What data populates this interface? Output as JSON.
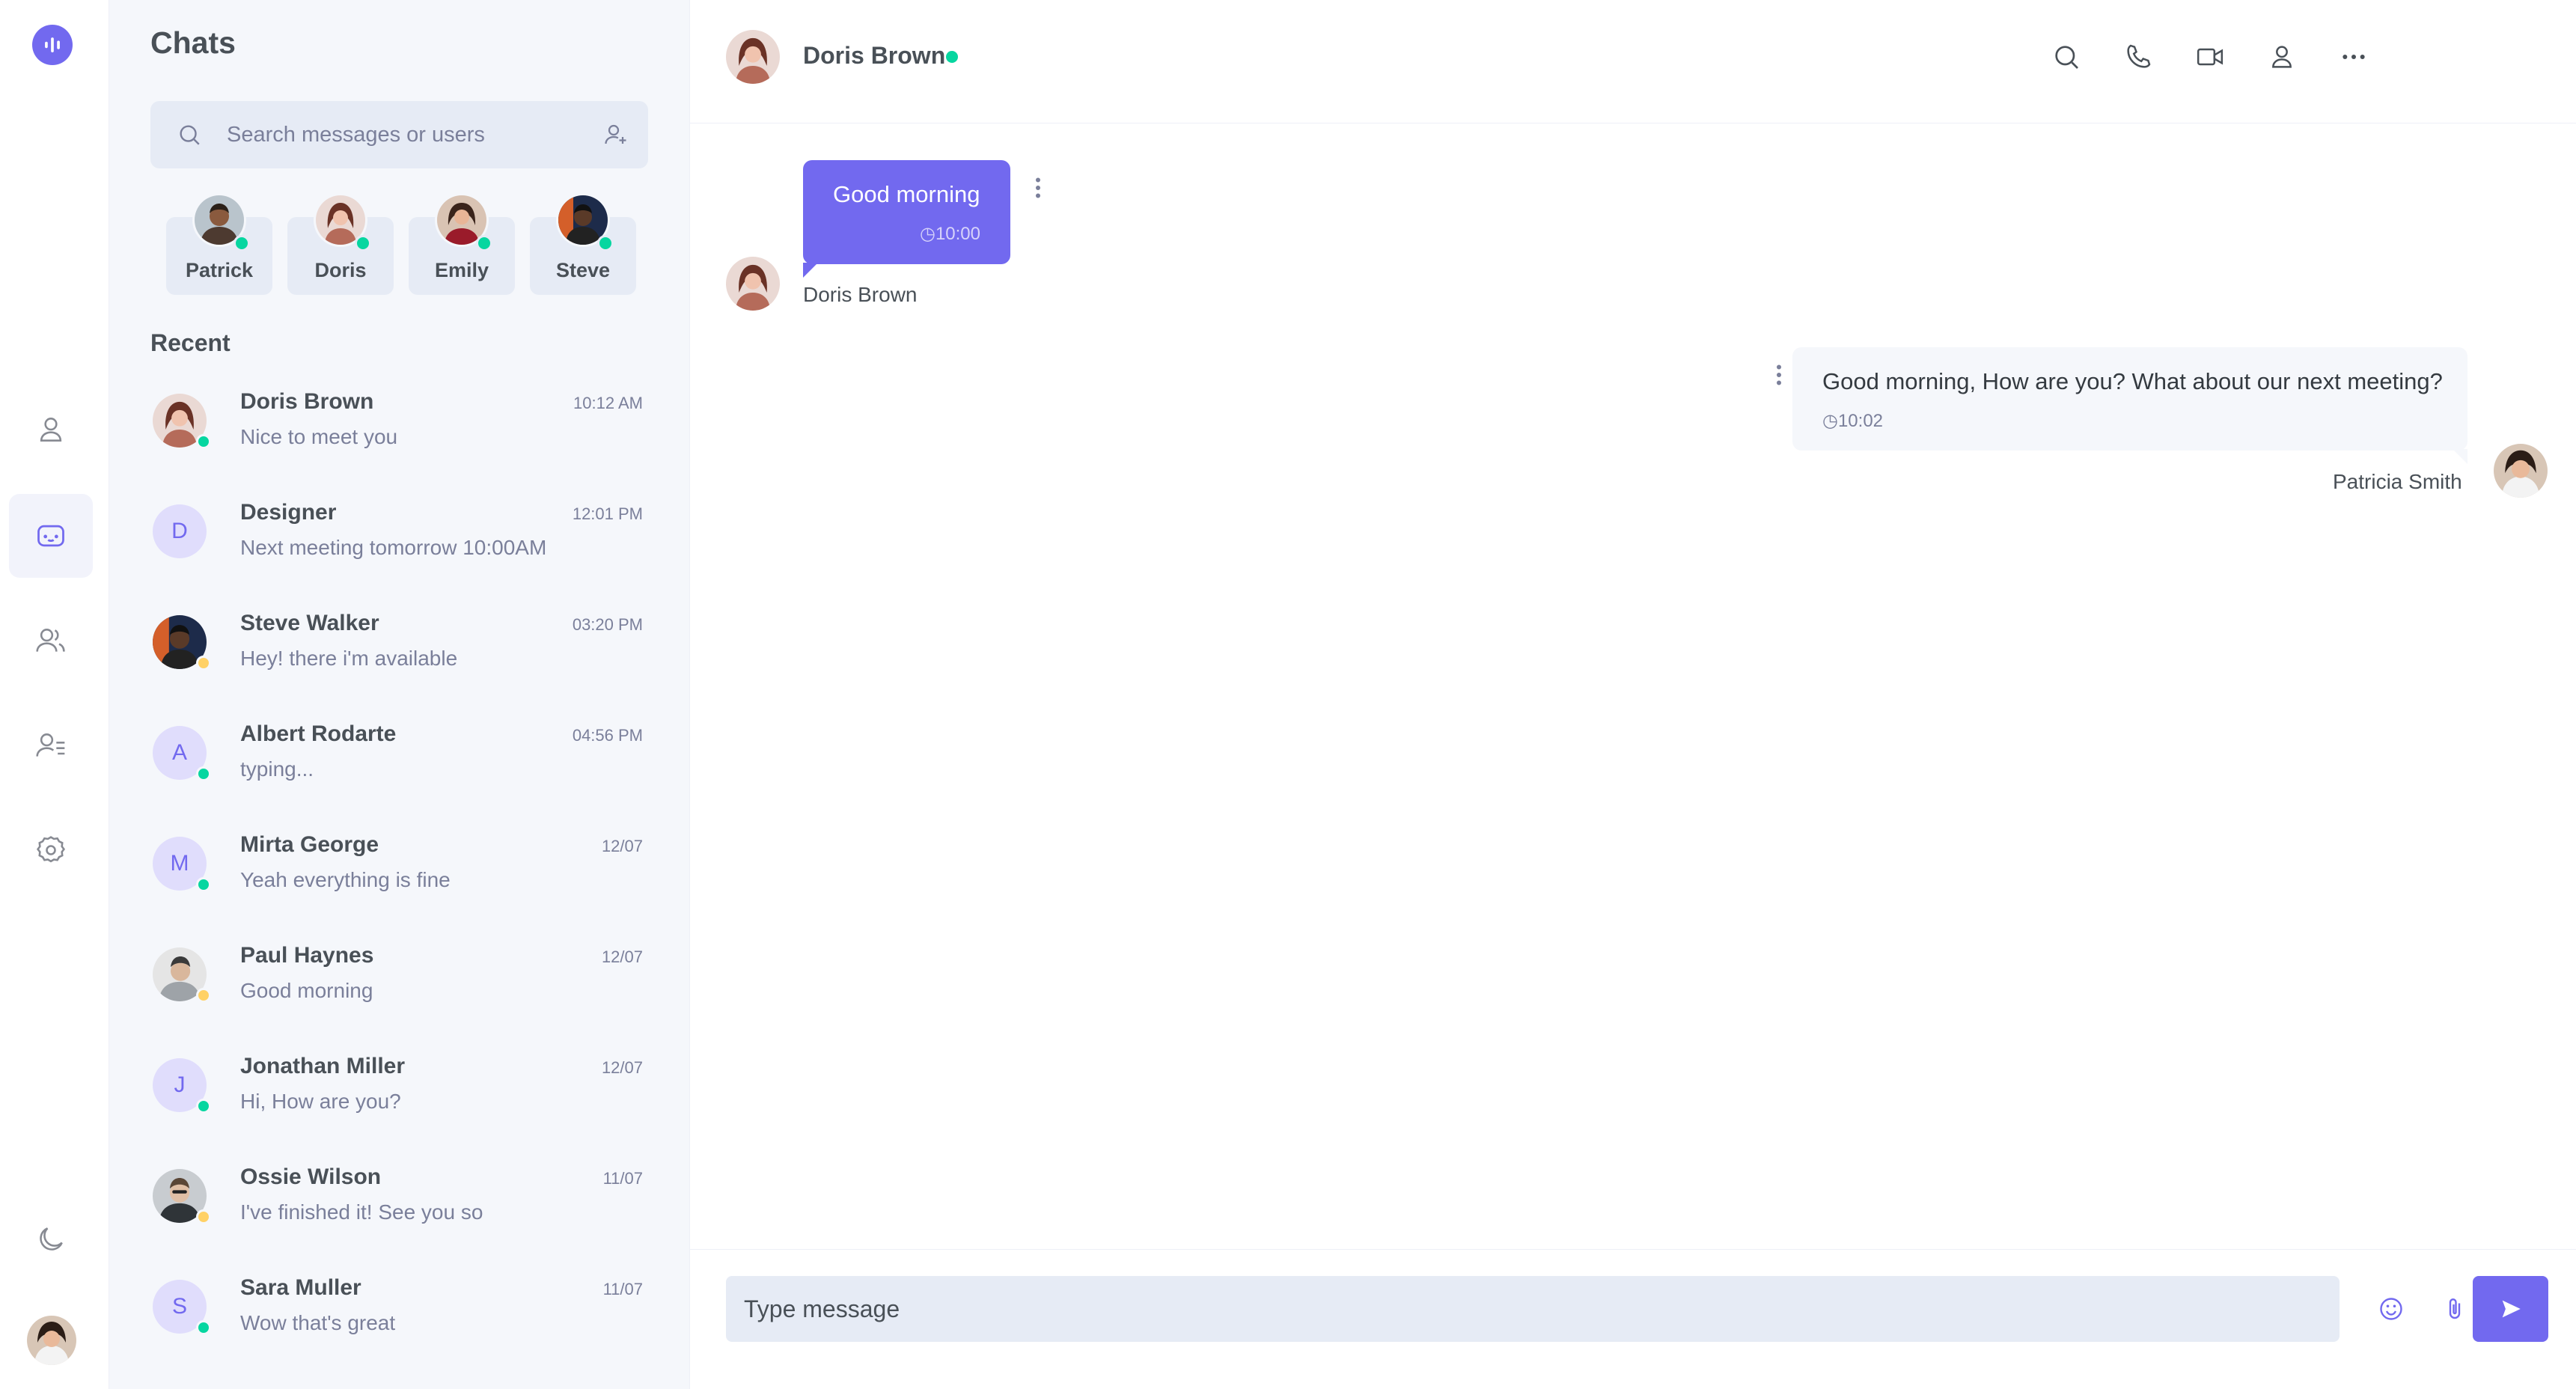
{
  "colors": {
    "accent": "#7269ef",
    "online": "#06d6a0",
    "away": "#ffd166",
    "panel_bg": "#f5f7fb",
    "input_bg": "#e6ebf5"
  },
  "rail": {
    "items": [
      {
        "icon": "user-icon",
        "label": "Profile"
      },
      {
        "icon": "chat-icon",
        "label": "Chats",
        "active": true
      },
      {
        "icon": "group-icon",
        "label": "Groups"
      },
      {
        "icon": "contacts-icon",
        "label": "Contacts"
      },
      {
        "icon": "settings-icon",
        "label": "Settings"
      }
    ],
    "bottom": [
      "moon-icon",
      "avatar"
    ]
  },
  "sidebar": {
    "title": "Chats",
    "search_placeholder": "Search messages or users",
    "online_users": [
      {
        "name": "Patrick",
        "status": "online"
      },
      {
        "name": "Doris",
        "status": "online"
      },
      {
        "name": "Emily",
        "status": "online"
      },
      {
        "name": "Steve",
        "status": "online"
      }
    ],
    "recent_title": "Recent",
    "conversations": [
      {
        "name": "Doris Brown",
        "last": "Nice to meet you",
        "time": "10:12 AM",
        "initial": "",
        "status": "online"
      },
      {
        "name": "Designer",
        "last": "Next meeting tomorrow 10:00AM",
        "time": "12:01 PM",
        "initial": "D",
        "status": ""
      },
      {
        "name": "Steve Walker",
        "last": "Hey! there i'm available",
        "time": "03:20 PM",
        "initial": "",
        "status": "away"
      },
      {
        "name": "Albert Rodarte",
        "last": "typing...",
        "time": "04:56 PM",
        "initial": "A",
        "status": "online"
      },
      {
        "name": "Mirta George",
        "last": "Yeah everything is fine",
        "time": "12/07",
        "initial": "M",
        "status": "online"
      },
      {
        "name": "Paul Haynes",
        "last": "Good morning",
        "time": "12/07",
        "initial": "",
        "status": "away"
      },
      {
        "name": "Jonathan Miller",
        "last": "Hi, How are you?",
        "time": "12/07",
        "initial": "J",
        "status": "online"
      },
      {
        "name": "Ossie Wilson",
        "last": "I've finished it! See you so",
        "time": "11/07",
        "initial": "",
        "status": "away"
      },
      {
        "name": "Sara Muller",
        "last": "Wow that's great",
        "time": "11/07",
        "initial": "S",
        "status": "online"
      }
    ]
  },
  "conversation": {
    "contact_name": "Doris Brown",
    "contact_status": "online",
    "toolbar": [
      "search-icon",
      "phone-icon",
      "video-icon",
      "user-icon",
      "more-icon"
    ],
    "messages": [
      {
        "direction": "in",
        "text": "Good morning",
        "time": "10:00",
        "sender": "Doris Brown"
      },
      {
        "direction": "out",
        "text": "Good morning, How are you? What about our next meeting?",
        "time": "10:02",
        "sender": "Patricia Smith"
      }
    ],
    "input_placeholder": "Type message"
  }
}
